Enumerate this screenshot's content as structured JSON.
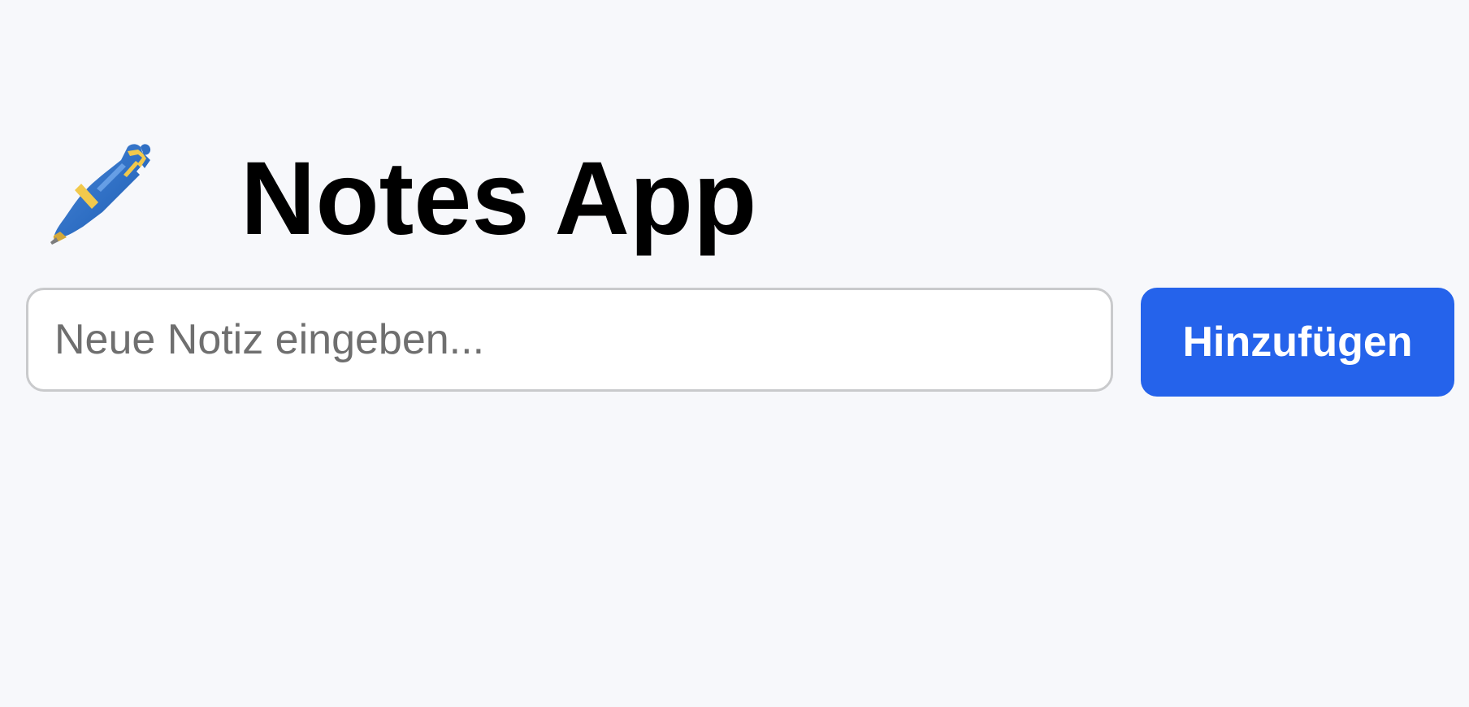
{
  "header": {
    "icon": "pen-icon",
    "title": "Notes App"
  },
  "note_input": {
    "value": "",
    "placeholder": "Neue Notiz eingeben..."
  },
  "add_button": {
    "label": "Hinzufügen"
  },
  "colors": {
    "background": "#f7f8fb",
    "accent": "#2563eb",
    "input_border": "#c9cacc",
    "placeholder": "#6f6f6f",
    "pen_blue": "#2f6fc4",
    "pen_gold": "#f2c94c"
  }
}
